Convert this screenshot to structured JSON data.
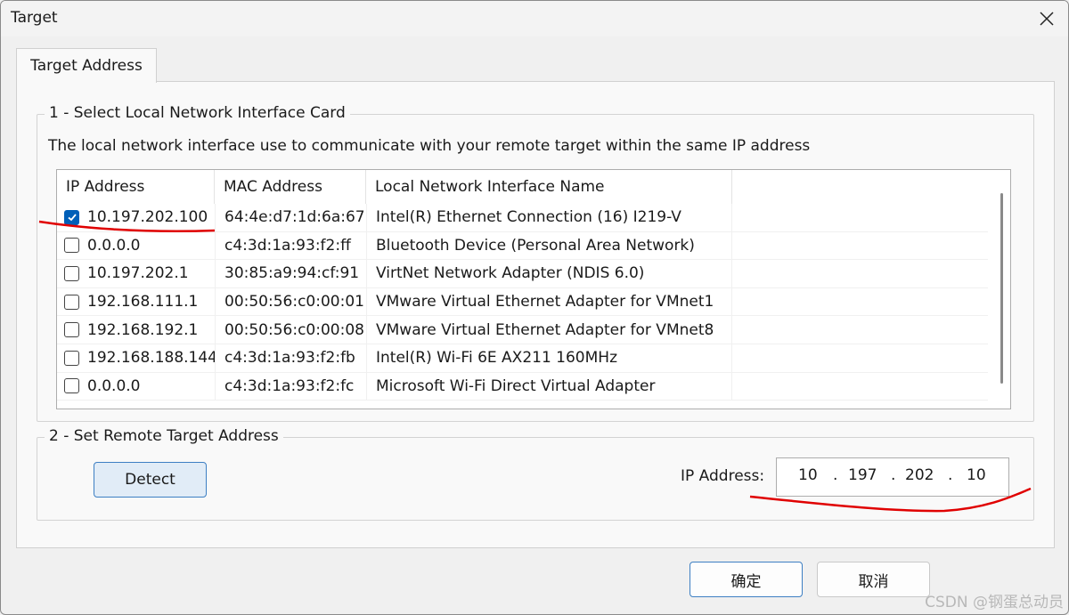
{
  "window": {
    "title": "Target"
  },
  "tab": {
    "label": "Target Address"
  },
  "section1": {
    "legend": "1 - Select Local Network Interface Card",
    "description": "The local network interface use to communicate with your remote target within the same IP address",
    "columns": [
      "IP Address",
      "MAC Address",
      "Local Network Interface Name"
    ],
    "rows": [
      {
        "checked": true,
        "ip": "10.197.202.100",
        "mac": "64:4e:d7:1d:6a:67",
        "name": "Intel(R) Ethernet Connection (16) I219-V"
      },
      {
        "checked": false,
        "ip": "0.0.0.0",
        "mac": "c4:3d:1a:93:f2:ff",
        "name": "Bluetooth Device (Personal Area Network)"
      },
      {
        "checked": false,
        "ip": "10.197.202.1",
        "mac": "30:85:a9:94:cf:91",
        "name": "VirtNet Network Adapter (NDIS 6.0)"
      },
      {
        "checked": false,
        "ip": "192.168.111.1",
        "mac": "00:50:56:c0:00:01",
        "name": "VMware Virtual Ethernet Adapter for VMnet1"
      },
      {
        "checked": false,
        "ip": "192.168.192.1",
        "mac": "00:50:56:c0:00:08",
        "name": "VMware Virtual Ethernet Adapter for VMnet8"
      },
      {
        "checked": false,
        "ip": "192.168.188.144",
        "mac": "c4:3d:1a:93:f2:fb",
        "name": "Intel(R) Wi-Fi 6E AX211 160MHz"
      },
      {
        "checked": false,
        "ip": "0.0.0.0",
        "mac": "c4:3d:1a:93:f2:fc",
        "name": "Microsoft Wi-Fi Direct Virtual Adapter"
      }
    ]
  },
  "section2": {
    "legend": "2 - Set Remote Target Address",
    "detect_label": "Detect",
    "ip_label": "IP Address:",
    "ip_octets": [
      "10",
      "197",
      "202",
      "10"
    ]
  },
  "buttons": {
    "ok": "确定",
    "cancel": "取消"
  },
  "watermark": "CSDN @钢蛋总动员",
  "colors": {
    "accent": "#005fb8",
    "annotation": "#e00000"
  }
}
